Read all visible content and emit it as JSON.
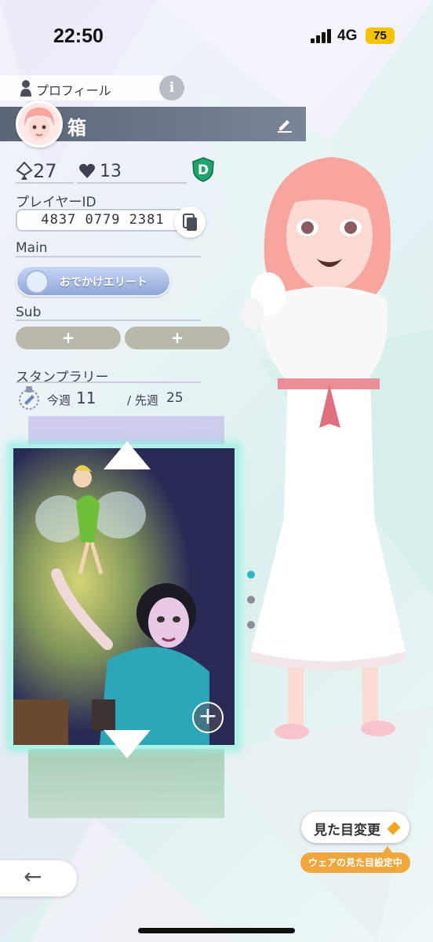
{
  "status_bar": {
    "time": "22:50",
    "network": "4G",
    "battery": "75"
  },
  "profile": {
    "tab_label": "プロフィール",
    "info_label": "i",
    "name": "箱",
    "diamonds": "27",
    "likes": "13",
    "rank": "D",
    "player_id_label": "プレイヤーID",
    "player_id": "4837 0779 2381",
    "main_label": "Main",
    "main_title": "おでかけエリート",
    "sub_label": "Sub",
    "sub_add_1": "+",
    "sub_add_2": "+",
    "stamp_label": "スタンプラリー",
    "this_week_label": "今週",
    "this_week_value": "11",
    "last_week_label": "/ 先週",
    "last_week_value": "25"
  },
  "card": {
    "add_label": "+"
  },
  "carousel": {
    "active_index": 0,
    "count": 3
  },
  "actions": {
    "change_look": "見た目変更",
    "wear_status": "ウェアの見た目設定中",
    "back": "←"
  },
  "colors": {
    "accent": "#2bb8c2",
    "name_bar": "#5c6478",
    "wear_tag": "#f1a63b",
    "sub_button": "#b9b8aa"
  }
}
